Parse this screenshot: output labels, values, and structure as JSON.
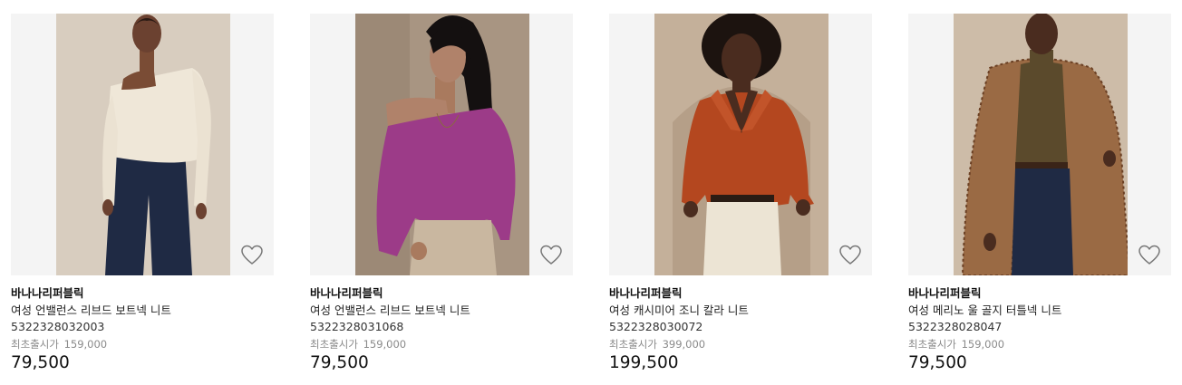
{
  "products": [
    {
      "brand": "바나나리퍼블릭",
      "name": "여성 언밸런스 리브드 보트넥 니트",
      "code": "5322328032003",
      "original_label": "최초출시가",
      "original_price": "159,000",
      "price": "79,500",
      "image": "woman-ivory-off-shoulder-knit",
      "wishlist_icon": "heart-outline-icon"
    },
    {
      "brand": "바나나리퍼블릭",
      "name": "여성 언밸런스 리브드 보트넥 니트",
      "code": "5322328031068",
      "original_label": "최초출시가",
      "original_price": "159,000",
      "price": "79,500",
      "image": "woman-magenta-off-shoulder-knit",
      "wishlist_icon": "heart-outline-icon"
    },
    {
      "brand": "바나나리퍼블릭",
      "name": "여성 캐시미어 조니 칼라 니트",
      "code": "5322328030072",
      "original_label": "최초출시가",
      "original_price": "399,000",
      "price": "199,500",
      "image": "woman-rust-johnny-collar-knit",
      "wishlist_icon": "heart-outline-icon"
    },
    {
      "brand": "바나나리퍼블릭",
      "name": "여성 메리노 울 골지 터틀넥 니트",
      "code": "5322328028047",
      "original_label": "최초출시가",
      "original_price": "159,000",
      "price": "79,500",
      "image": "woman-olive-turtleneck-houndstooth-coat",
      "wishlist_icon": "heart-outline-icon"
    }
  ],
  "colors": {
    "image_bg": "#f4f4f4",
    "photo_bg": "#d7cbbd",
    "muted_text": "#8a8a8a"
  }
}
